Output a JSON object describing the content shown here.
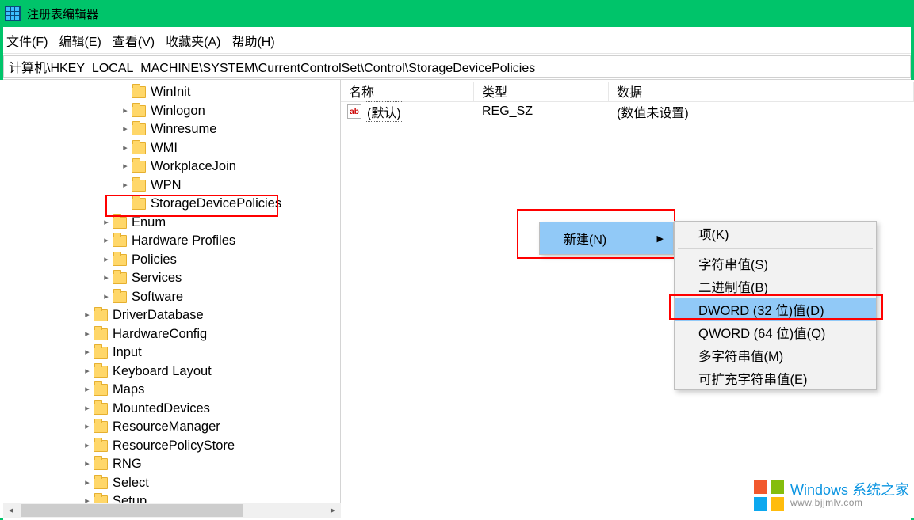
{
  "window": {
    "title": "注册表编辑器"
  },
  "menu": {
    "file": "文件(F)",
    "edit": "编辑(E)",
    "view": "查看(V)",
    "favorites": "收藏夹(A)",
    "help": "帮助(H)"
  },
  "address": "计算机\\HKEY_LOCAL_MACHINE\\SYSTEM\\CurrentControlSet\\Control\\StorageDevicePolicies",
  "tree": [
    {
      "indent": 150,
      "chev": "",
      "label": "WinInit"
    },
    {
      "indent": 150,
      "chev": ">",
      "label": "Winlogon"
    },
    {
      "indent": 150,
      "chev": ">",
      "label": "Winresume"
    },
    {
      "indent": 150,
      "chev": ">",
      "label": "WMI"
    },
    {
      "indent": 150,
      "chev": ">",
      "label": "WorkplaceJoin"
    },
    {
      "indent": 150,
      "chev": ">",
      "label": "WPN"
    },
    {
      "indent": 150,
      "chev": "",
      "label": "StorageDevicePolicies",
      "box": true
    },
    {
      "indent": 126,
      "chev": ">",
      "label": "Enum"
    },
    {
      "indent": 126,
      "chev": ">",
      "label": "Hardware Profiles"
    },
    {
      "indent": 126,
      "chev": ">",
      "label": "Policies"
    },
    {
      "indent": 126,
      "chev": ">",
      "label": "Services"
    },
    {
      "indent": 126,
      "chev": ">",
      "label": "Software"
    },
    {
      "indent": 102,
      "chev": ">",
      "label": "DriverDatabase"
    },
    {
      "indent": 102,
      "chev": ">",
      "label": "HardwareConfig"
    },
    {
      "indent": 102,
      "chev": ">",
      "label": "Input"
    },
    {
      "indent": 102,
      "chev": ">",
      "label": "Keyboard Layout"
    },
    {
      "indent": 102,
      "chev": ">",
      "label": "Maps"
    },
    {
      "indent": 102,
      "chev": ">",
      "label": "MountedDevices"
    },
    {
      "indent": 102,
      "chev": ">",
      "label": "ResourceManager"
    },
    {
      "indent": 102,
      "chev": ">",
      "label": "ResourcePolicyStore"
    },
    {
      "indent": 102,
      "chev": ">",
      "label": "RNG"
    },
    {
      "indent": 102,
      "chev": ">",
      "label": "Select"
    },
    {
      "indent": 102,
      "chev": ">",
      "label": "Setup"
    }
  ],
  "values": {
    "headers": {
      "name": "名称",
      "type": "类型",
      "data": "数据"
    },
    "rows": [
      {
        "icon": "ab",
        "name": "(默认)",
        "type": "REG_SZ",
        "data": "(数值未设置)"
      }
    ]
  },
  "context": {
    "parent_label": "新建(N)",
    "sub": {
      "key": "项(K)",
      "string": "字符串值(S)",
      "binary": "二进制值(B)",
      "dword": "DWORD (32 位)值(D)",
      "qword": "QWORD (64 位)值(Q)",
      "multi": "多字符串值(M)",
      "expand": "可扩充字符串值(E)"
    }
  },
  "watermark": {
    "line1": "Windows 系统之家",
    "line2": "www.bjjmlv.com"
  }
}
